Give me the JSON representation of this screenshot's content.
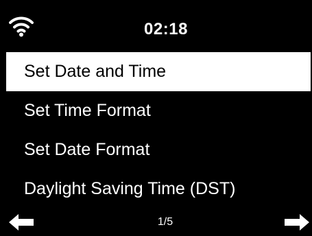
{
  "status_bar": {
    "time": "02:18",
    "wifi_icon": "wifi-icon"
  },
  "menu": {
    "items": [
      {
        "label": "Set Date and Time",
        "selected": true
      },
      {
        "label": "Set Time Format",
        "selected": false
      },
      {
        "label": "Set Date Format",
        "selected": false
      },
      {
        "label": "Daylight Saving Time (DST)",
        "selected": false
      }
    ]
  },
  "footer": {
    "page": "1/5",
    "left_icon": "arrow-left-icon",
    "right_icon": "arrow-right-icon"
  },
  "colors": {
    "background": "#000000",
    "foreground": "#ffffff",
    "highlight": "#ffffff"
  }
}
